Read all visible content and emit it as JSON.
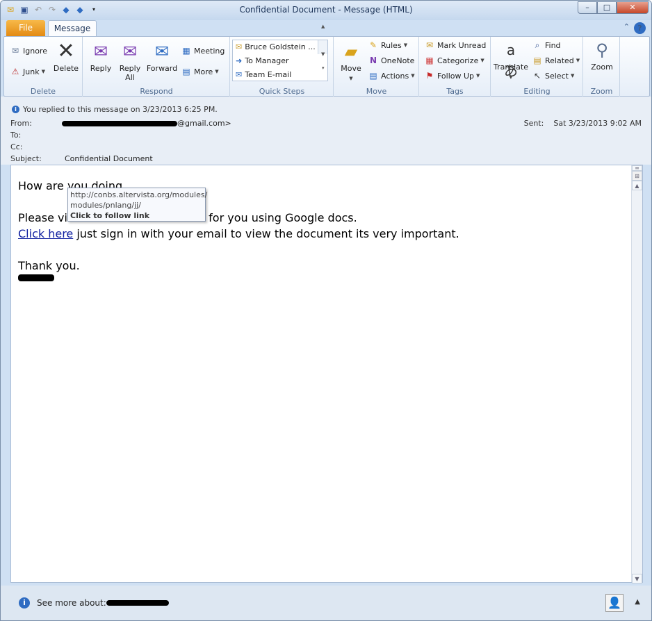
{
  "window": {
    "title": "Confidential Document  -  Message (HTML)",
    "min": "–",
    "max": "□",
    "close": "✕"
  },
  "tabs": {
    "file": "File",
    "message": "Message"
  },
  "ribbon": {
    "delete": {
      "ignore": "Ignore",
      "junk": "Junk",
      "delete": "Delete",
      "label": "Delete"
    },
    "respond": {
      "reply": "Reply",
      "reply_all_1": "Reply",
      "reply_all_2": "All",
      "forward": "Forward",
      "meeting": "Meeting",
      "more": "More",
      "label": "Respond"
    },
    "quick_steps": {
      "items": [
        "Bruce Goldstein ...",
        "To Manager",
        "Team E-mail"
      ],
      "label": "Quick Steps"
    },
    "move": {
      "move": "Move",
      "rules": "Rules",
      "onenote": "OneNote",
      "actions": "Actions",
      "label": "Move"
    },
    "tags": {
      "mark_unread": "Mark Unread",
      "categorize": "Categorize",
      "follow_up": "Follow Up",
      "label": "Tags"
    },
    "editing": {
      "translate": "Translate",
      "find": "Find",
      "related": "Related",
      "select": "Select",
      "label": "Editing"
    },
    "zoom": {
      "zoom": "Zoom",
      "label": "Zoom"
    }
  },
  "header": {
    "replied": "You replied to this message on 3/23/2013 6:25 PM.",
    "from_label": "From:",
    "from_suffix": "@gmail.com>",
    "to_label": "To:",
    "cc_label": "Cc:",
    "subject_label": "Subject:",
    "subject": "Confidential Document",
    "sent_label": "Sent:",
    "sent": "Sat 3/23/2013 9:02 AM"
  },
  "body": {
    "line1": "How are you doing.",
    "line2_pre": "Please vi",
    "line2_post": "ded for you using Google docs.",
    "link": "Click here",
    "line3_rest": " just sign in with your email to view the document its very important.",
    "thanks": "Thank you."
  },
  "tooltip": {
    "url1": "http://conbs.altervista.org/modules/",
    "url2": "modules/pnlang/jj/",
    "hint": "Click to follow link"
  },
  "footer": {
    "see_more": "See more about:"
  }
}
